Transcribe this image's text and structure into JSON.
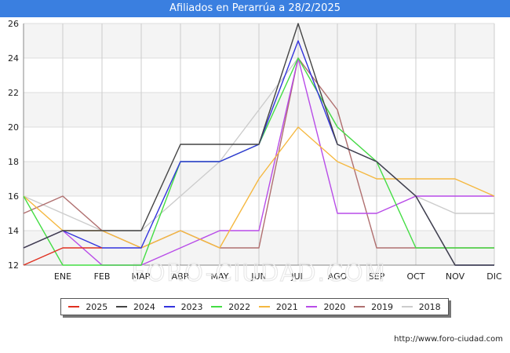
{
  "title": "Afiliados en Perarrúa a 28/2/2025",
  "source": "http://www.foro-ciudad.com",
  "watermark": "FORO-CIUDAD.COM",
  "chart_data": {
    "type": "line",
    "title": "Afiliados en Perarrúa a 28/2/2025",
    "xlabel": "",
    "ylabel": "",
    "categories": [
      "",
      "ENE",
      "FEB",
      "MAR",
      "ABR",
      "MAY",
      "JUN",
      "JUL",
      "AGO",
      "SEP",
      "OCT",
      "NOV",
      "DIC"
    ],
    "ylim": [
      12,
      26
    ],
    "yticks": [
      12,
      14,
      16,
      18,
      20,
      22,
      24,
      26
    ],
    "grid": true,
    "legend_position": "bottom",
    "series": [
      {
        "name": "2018",
        "color": "#cccccc",
        "values": [
          16,
          15,
          14,
          14,
          16,
          18,
          21,
          24,
          20,
          18,
          16,
          15,
          15
        ]
      },
      {
        "name": "2019",
        "color": "#b07070",
        "values": [
          15,
          16,
          14,
          13,
          14,
          13,
          13,
          24,
          21,
          13,
          13,
          13,
          13
        ]
      },
      {
        "name": "2020",
        "color": "#b84ce8",
        "values": [
          13,
          14,
          12,
          12,
          13,
          14,
          14,
          24,
          15,
          15,
          16,
          16,
          16
        ]
      },
      {
        "name": "2021",
        "color": "#f5b840",
        "values": [
          16,
          14,
          14,
          13,
          14,
          13,
          17,
          20,
          18,
          17,
          17,
          17,
          16
        ]
      },
      {
        "name": "2022",
        "color": "#44dd44",
        "values": [
          16,
          12,
          12,
          12,
          18,
          18,
          19,
          24,
          20,
          18,
          13,
          13,
          13
        ]
      },
      {
        "name": "2023",
        "color": "#3333dd",
        "values": [
          13,
          14,
          13,
          13,
          18,
          18,
          19,
          25,
          19,
          18,
          16,
          12,
          12
        ]
      },
      {
        "name": "2024",
        "color": "#444444",
        "values": [
          13,
          14,
          14,
          14,
          19,
          19,
          19,
          26,
          19,
          18,
          16,
          12,
          12
        ]
      },
      {
        "name": "2025",
        "color": "#e03020",
        "values": [
          12,
          13,
          13
        ]
      }
    ],
    "legend_order": [
      "2025",
      "2024",
      "2023",
      "2022",
      "2021",
      "2020",
      "2019",
      "2018"
    ]
  }
}
